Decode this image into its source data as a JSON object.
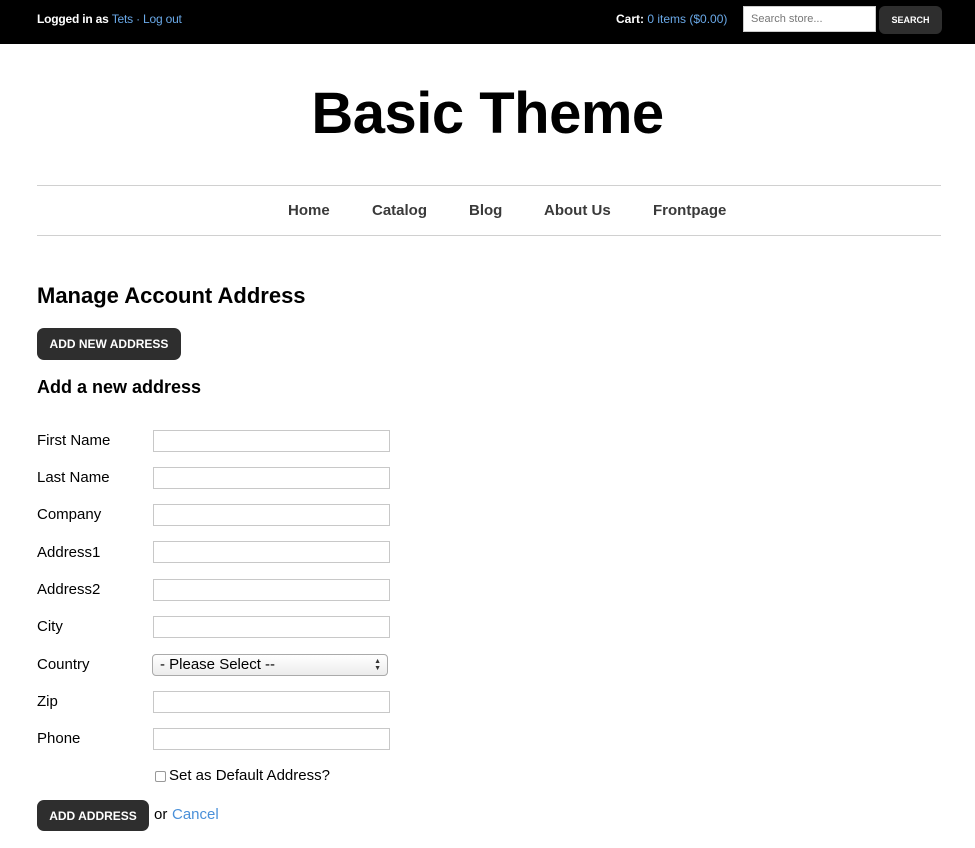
{
  "topbar": {
    "logged_in_as": "Logged in as",
    "username": "Tets",
    "separator": "·",
    "logout": "Log out",
    "cart_label": "Cart:",
    "cart_value": "0 items ($0.00)",
    "search_placeholder": "Search store...",
    "search_button": "SEARCH"
  },
  "site_title": "Basic Theme",
  "nav": {
    "items": [
      "Home",
      "Catalog",
      "Blog",
      "About Us",
      "Frontpage"
    ]
  },
  "page": {
    "title": "Manage Account Address",
    "add_new_button": "ADD NEW ADDRESS",
    "subtitle": "Add a new address"
  },
  "form": {
    "labels": {
      "first_name": "First Name",
      "last_name": "Last Name",
      "company": "Company",
      "address1": "Address1",
      "address2": "Address2",
      "city": "City",
      "country": "Country",
      "zip": "Zip",
      "phone": "Phone"
    },
    "values": {
      "first_name": "",
      "last_name": "",
      "company": "",
      "address1": "",
      "address2": "",
      "city": "",
      "zip": "",
      "phone": ""
    },
    "country_selected": "- Please Select --",
    "default_checkbox_label": "Set as Default Address?",
    "default_checked": false,
    "submit_button": "ADD ADDRESS",
    "or_text": "or",
    "cancel_link": "Cancel"
  }
}
